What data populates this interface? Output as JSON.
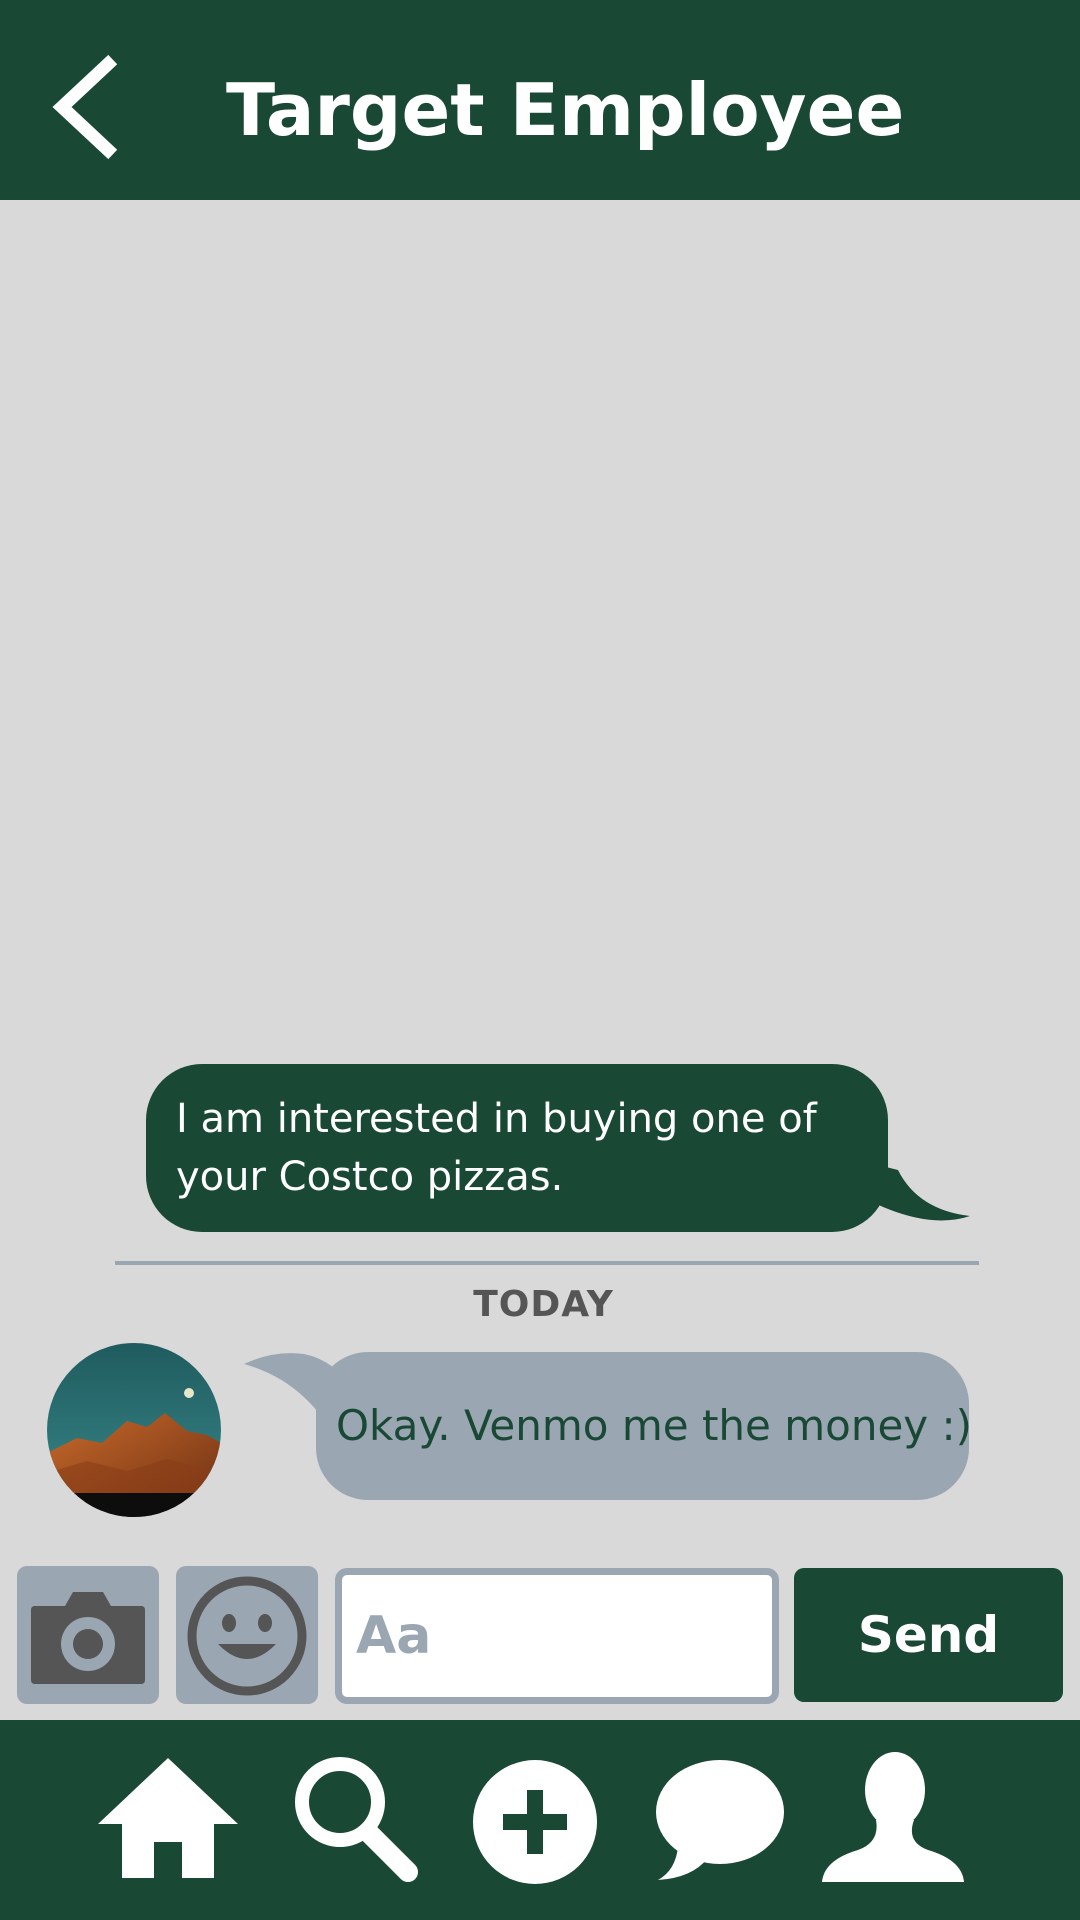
{
  "header": {
    "title": "Target Employee",
    "back_icon": "chevron-left-icon"
  },
  "messages": {
    "outgoing": {
      "text": "I am interested in buying one of your Costco pizzas."
    },
    "date_divider": "TODAY",
    "incoming": {
      "text": "Okay. Venmo me the money :)"
    }
  },
  "composer": {
    "placeholder": "Aa",
    "value": "",
    "send_label": "Send",
    "camera_icon": "camera-icon",
    "emoji_icon": "smiley-icon"
  },
  "bottom_nav": {
    "items": [
      {
        "icon": "home-icon"
      },
      {
        "icon": "search-icon"
      },
      {
        "icon": "plus-circle-icon"
      },
      {
        "icon": "chat-bubble-icon"
      },
      {
        "icon": "profile-icon"
      }
    ]
  },
  "colors": {
    "primary": "#194834",
    "secondary": "#9aa6b2",
    "background": "#d9d9d9",
    "text_dark": "#555555"
  }
}
